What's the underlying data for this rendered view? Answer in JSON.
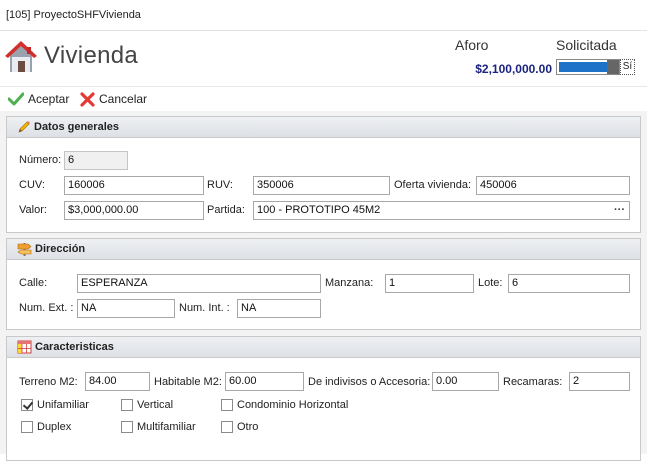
{
  "window": {
    "title": "[105] ProyectoSHFVivienda"
  },
  "header": {
    "title": "Vivienda",
    "aforo_label": "Aforo",
    "solicitada_label": "Solicitada",
    "aforo_value": "$2,100,000.00",
    "solicitada_toggle_text": "Sí",
    "solicitada_on": true,
    "accent_color": "#1e73c9"
  },
  "toolbar": {
    "accept_label": "Aceptar",
    "cancel_label": "Cancelar"
  },
  "datos_generales": {
    "title": "Datos generales",
    "numero_label": "Número:",
    "numero_value": "6",
    "cuv_label": "CUV:",
    "cuv_value": "160006",
    "ruv_label": "RUV:",
    "ruv_value": "350006",
    "oferta_label": "Oferta vivienda:",
    "oferta_value": "450006",
    "valor_label": "Valor:",
    "valor_value": "$3,000,000.00",
    "partida_label": "Partida:",
    "partida_value": "100 - PROTOTIPO 45M2",
    "partida_button": "···"
  },
  "direccion": {
    "title": "Dirección",
    "calle_label": "Calle:",
    "calle_value": "ESPERANZA",
    "manzana_label": "Manzana:",
    "manzana_value": "1",
    "lote_label": "Lote:",
    "lote_value": "6",
    "num_ext_label": "Num. Ext. :",
    "num_ext_value": "NA",
    "num_int_label": "Num. Int. :",
    "num_int_value": "NA"
  },
  "caracteristicas": {
    "title": "Caracteristicas",
    "terreno_label": "Terreno M2:",
    "terreno_value": "84.00",
    "habitable_label": "Habitable M2:",
    "habitable_value": "60.00",
    "indivisos_label": "De indivisos o Accesoria:",
    "indivisos_value": "0.00",
    "recamaras_label": "Recamaras:",
    "recamaras_value": "2",
    "options": [
      {
        "label": "Unifamiliar",
        "checked": true
      },
      {
        "label": "Vertical",
        "checked": false
      },
      {
        "label": "Condominio Horizontal",
        "checked": false
      },
      {
        "label": "Duplex",
        "checked": false
      },
      {
        "label": "Multifamiliar",
        "checked": false
      },
      {
        "label": "Otro",
        "checked": false
      }
    ]
  }
}
